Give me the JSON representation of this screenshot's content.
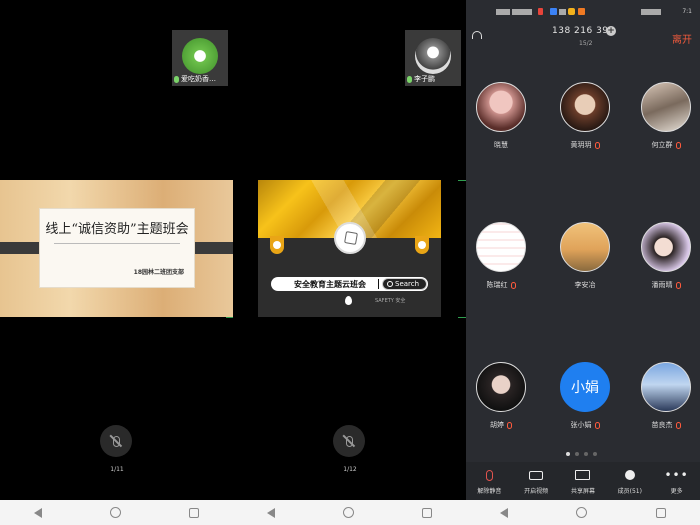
{
  "left_phone": {
    "thumb_name": "爱吃奶香…",
    "slide_title": "线上“诚信资助”主题班会",
    "slide_subtitle": "18园林二班团支部",
    "page_indicator": "1/11"
  },
  "middle_phone": {
    "thumb_name": "李子鹏",
    "search_text": "安全教育主题云班会",
    "search_button": "Search",
    "footer_small": "SAFETY 安全",
    "page_indicator": "1/12"
  },
  "right_phone": {
    "status_clock": "7:1",
    "meeting_id": "138 216 397",
    "pages": "15/2",
    "leave_label": "离开",
    "members": [
      {
        "name": "晓慧"
      },
      {
        "name": "黄玥玥"
      },
      {
        "name": "何立群"
      },
      {
        "name": "陈瑞红"
      },
      {
        "name": "李安冶"
      },
      {
        "name": "潘雨晴"
      },
      {
        "name": "胡婷"
      },
      {
        "name": "张小娟",
        "avatar_text": "小娟"
      },
      {
        "name": "苗良杰"
      }
    ],
    "toolbar": [
      {
        "label": "解除静音",
        "icon": "mic-muted-icon"
      },
      {
        "label": "开启视频",
        "icon": "camera-off-icon"
      },
      {
        "label": "共享屏幕",
        "icon": "share-screen-icon"
      },
      {
        "label": "成员(51)",
        "icon": "members-icon"
      },
      {
        "label": "更多",
        "icon": "more-icon"
      }
    ]
  },
  "colors": {
    "accent_red": "#f05a3c",
    "avatar_blue": "#1f7ff0",
    "panel_dark": "#2a2c31"
  }
}
